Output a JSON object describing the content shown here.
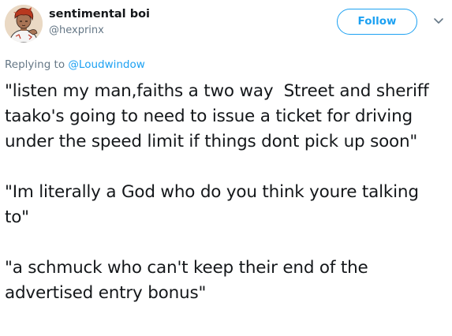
{
  "tweet": {
    "author": {
      "display_name": "sentimental boi",
      "handle": "@hexprinx"
    },
    "follow_label": "Follow",
    "reply_prefix": "Replying to ",
    "reply_to": "@Loudwindow",
    "paragraphs": [
      "\"listen my man,faiths a two way  Street and sheriff taako's going to need to issue a ticket for driving under the speed limit if things dont pick up soon\"",
      "\"Im literally a God who do you think youre talking to\"",
      "\"a schmuck who can't keep their end of the advertised entry bonus\""
    ]
  },
  "icons": {
    "avatar": "avatar-illustration",
    "more": "chevron-down-icon"
  },
  "colors": {
    "accent": "#1da1f2",
    "text": "#14171a",
    "secondary": "#657786",
    "background": "#ffffff"
  }
}
